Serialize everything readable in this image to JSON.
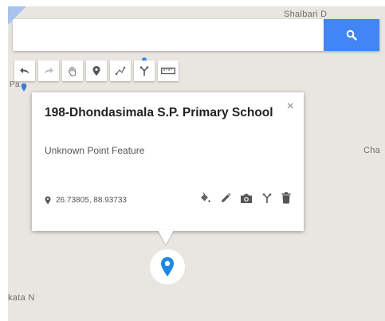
{
  "map": {
    "labels": {
      "top_right": "Shalbari D",
      "right_mid": "Cha",
      "bottom_left": "kata N",
      "left_small": "Pa"
    }
  },
  "search": {
    "value": "",
    "placeholder": ""
  },
  "toolbar": {
    "tools": [
      {
        "icon": "undo-arrow-icon",
        "active": false
      },
      {
        "icon": "redo-arrow-icon",
        "active": false
      },
      {
        "icon": "hand-pan-icon",
        "active": false
      },
      {
        "icon": "add-marker-icon",
        "active": false
      },
      {
        "icon": "draw-line-icon",
        "active": false
      },
      {
        "icon": "route-directions-icon",
        "active": true
      },
      {
        "icon": "ruler-icon",
        "active": false
      }
    ]
  },
  "popup": {
    "title": "198-Dhondasimala S.P. Primary School",
    "close": "×",
    "subtitle": "Unknown Point Feature",
    "coordinates": "26.73805, 88.93733",
    "actions": [
      "paint-bucket-icon",
      "pencil-edit-icon",
      "camera-icon",
      "directions-fork-icon",
      "trash-icon"
    ]
  },
  "colors": {
    "accent": "#4285f4",
    "marker": "#1e88e5",
    "map_bg": "#e9e6e1"
  }
}
